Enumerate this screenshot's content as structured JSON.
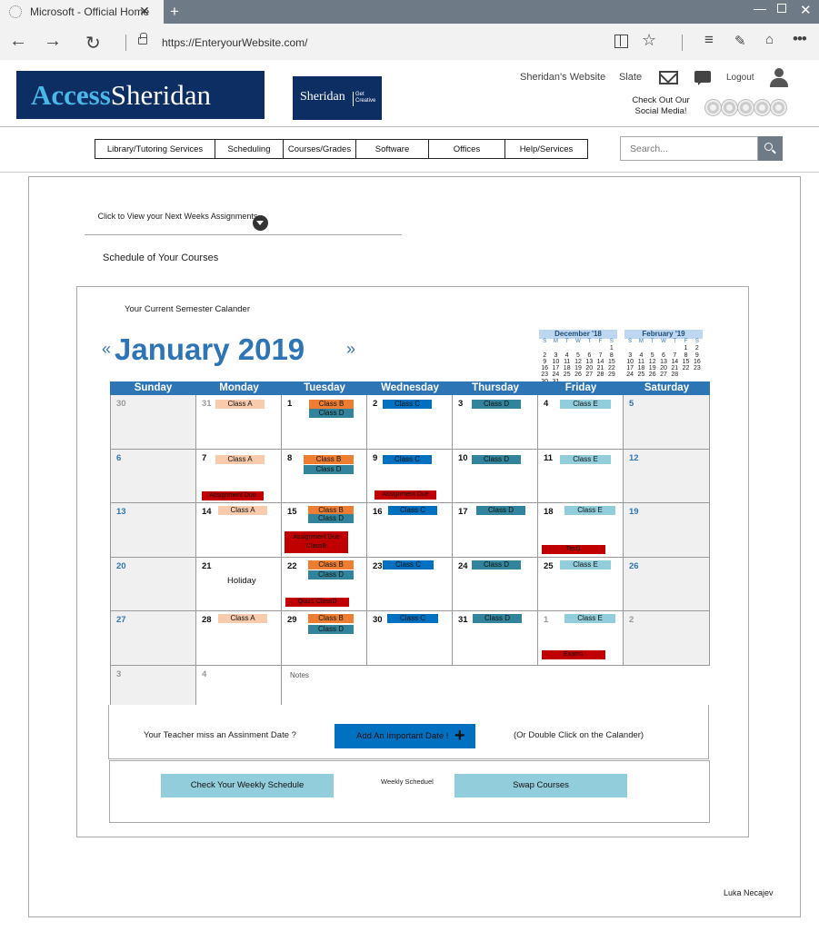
{
  "browser": {
    "tab_title": "Microsoft  - Official Home",
    "tab_close": "✕",
    "new_tab": "+",
    "url": "https://EnteryourWebsite.com/",
    "icons": [
      "back-icon",
      "forward-icon",
      "refresh-icon",
      "lock-icon",
      "reading-view-icon",
      "favorite-star-icon",
      "hub-icon",
      "web-note-icon",
      "share-icon",
      "more-icon"
    ]
  },
  "header": {
    "logo_access": "Access",
    "logo_sheridan_part": "Sheridan",
    "logo2": "Sheridan",
    "logo2_tagline": "Get Creative",
    "links": {
      "website": "Sheridan's Website",
      "slate": "Slate",
      "logout": "Logout"
    },
    "social_label": "Check Out Our Social Media!"
  },
  "nav": {
    "items": [
      "Library/Tutoring Services",
      "Scheduling",
      "Courses/Grades",
      "Software",
      "Offices",
      "Help/Services"
    ],
    "search_placeholder": "Search..."
  },
  "main": {
    "assignments_toggle": "Click to View your  Next Weeks Assignments",
    "schedule_title": "Schedule of Your Courses"
  },
  "calendar": {
    "current_label": "Your Current Semester Calander",
    "prev": "«",
    "next": "»",
    "month_title": "January 2019",
    "mini_dec": {
      "title": "December '18",
      "dow": [
        "S",
        "M",
        "T",
        "W",
        "T",
        "F",
        "S"
      ],
      "days": [
        "",
        "",
        "",
        "",
        "",
        "",
        "1",
        "2",
        "3",
        "4",
        "5",
        "6",
        "7",
        "8",
        "9",
        "10",
        "11",
        "12",
        "13",
        "14",
        "15",
        "16",
        "17",
        "18",
        "19",
        "20",
        "21",
        "22",
        "23",
        "24",
        "25",
        "26",
        "27",
        "28",
        "29",
        "30",
        "31",
        "",
        "",
        "",
        "",
        ""
      ]
    },
    "mini_feb": {
      "title": "February '19",
      "dow": [
        "S",
        "M",
        "T",
        "W",
        "T",
        "F",
        "S"
      ],
      "days": [
        "",
        "",
        "",
        "",
        "",
        "1",
        "2",
        "3",
        "4",
        "5",
        "6",
        "7",
        "8",
        "9",
        "10",
        "11",
        "12",
        "13",
        "14",
        "15",
        "16",
        "17",
        "18",
        "19",
        "20",
        "21",
        "22",
        "23",
        "24",
        "25",
        "26",
        "27",
        "28",
        ""
      ]
    },
    "days_of_week": [
      "Sunday",
      "Monday",
      "Tuesday",
      "Wednesday",
      "Thursday",
      "Friday",
      "Saturday"
    ],
    "weeks": [
      [
        "30",
        "31",
        "1",
        "2",
        "3",
        "4",
        "5"
      ],
      [
        "6",
        "7",
        "8",
        "9",
        "10",
        "11",
        "12"
      ],
      [
        "13",
        "14",
        "15",
        "16",
        "17",
        "18",
        "19"
      ],
      [
        "20",
        "21",
        "22",
        "23",
        "24",
        "25",
        "26"
      ],
      [
        "27",
        "28",
        "29",
        "30",
        "31",
        "1",
        "2"
      ],
      [
        "3",
        "4"
      ]
    ],
    "holiday": "Holiday",
    "notes_label": "Notes",
    "events": {
      "class_a": "Class A",
      "class_b": "Class B",
      "class_c": "Class C",
      "class_d": "Class D",
      "class_e": "Class E",
      "assignment_due": "Assignment Due",
      "assignment_due_classb": "Assignment Due ClassB",
      "test1": "Test1",
      "quiz1_classd": "Quiz1 ClassD",
      "exam1": "Exam1"
    },
    "colors": {
      "header": "#2e75b6",
      "class_a": "#f8cbad",
      "class_b": "#ed7d31",
      "class_c": "#0070c0",
      "class_d": "#31849b",
      "class_e": "#92cddc",
      "due": "#c00000"
    }
  },
  "actions": {
    "teacher_miss": "Your Teacher miss an Assinment Date ?",
    "add_date": "Add An Important Date !",
    "add_icon": "+",
    "double_click": "(Or Double Click on the Calander)",
    "weekly_schedule_btn": "Check Your Weekly Schedule",
    "weekly_label": "Weekly Scheduel",
    "swap_btn": "Swap Courses"
  },
  "footer": {
    "author": "Luka Necajev"
  }
}
